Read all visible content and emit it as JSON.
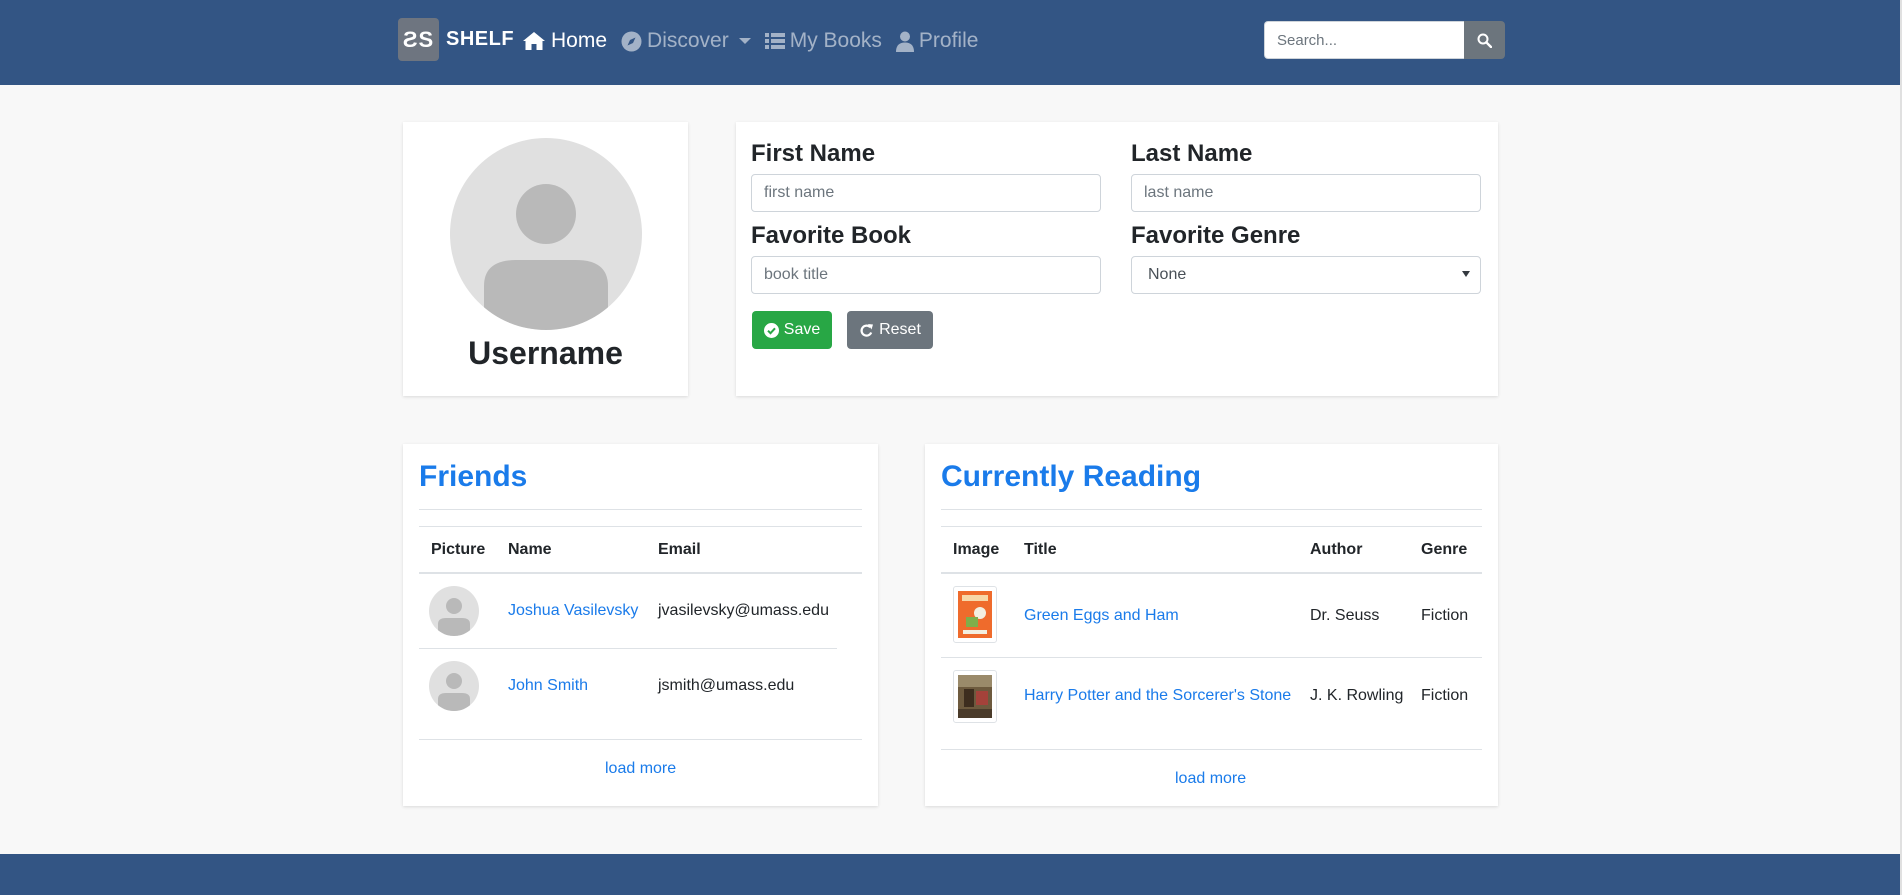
{
  "navbar": {
    "brand_logo": "ƧS",
    "brand_name": "SHELF",
    "items": [
      {
        "label": "Home",
        "icon": "home-icon",
        "active": true
      },
      {
        "label": "Discover",
        "icon": "compass-icon",
        "dropdown": true
      },
      {
        "label": "My Books",
        "icon": "list-icon"
      },
      {
        "label": "Profile",
        "icon": "user-icon"
      }
    ],
    "search_placeholder": "Search..."
  },
  "profile": {
    "username": "Username"
  },
  "form": {
    "first_name_label": "First Name",
    "first_name_placeholder": "first name",
    "last_name_label": "Last Name",
    "last_name_placeholder": "last name",
    "favorite_book_label": "Favorite Book",
    "favorite_book_placeholder": "book title",
    "favorite_genre_label": "Favorite Genre",
    "favorite_genre_value": "None",
    "save_label": "Save",
    "reset_label": "Reset"
  },
  "friends": {
    "title": "Friends",
    "headers": [
      "Picture",
      "Name",
      "Email"
    ],
    "rows": [
      {
        "name": "Joshua Vasilevsky",
        "email": "jvasilevsky@umass.edu"
      },
      {
        "name": "John Smith",
        "email": "jsmith@umass.edu"
      }
    ],
    "load_more": "load more"
  },
  "reading": {
    "title": "Currently Reading",
    "headers": [
      "Image",
      "Title",
      "Author",
      "Genre"
    ],
    "rows": [
      {
        "title": "Green Eggs and Ham",
        "author": "Dr. Seuss",
        "genre": "Fiction"
      },
      {
        "title": "Harry Potter and the Sorcerer's Stone",
        "author": "J. K. Rowling",
        "genre": "Fiction"
      }
    ],
    "load_more": "load more"
  },
  "colors": {
    "navbar": "#335584",
    "link": "#1a7bea",
    "save": "#28a745",
    "reset": "#6c757d"
  }
}
